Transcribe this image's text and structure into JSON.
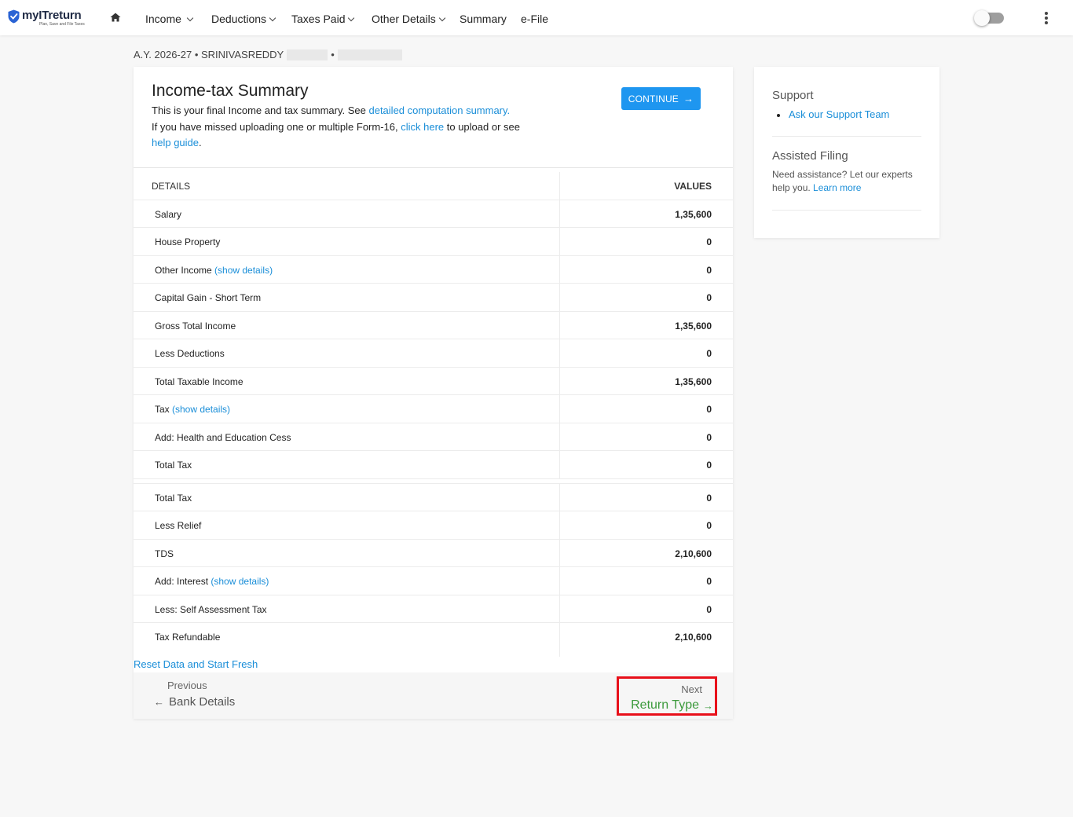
{
  "header": {
    "logo_name": "myITreturn",
    "logo_tagline": "Plan, Save and File Taxes",
    "nav": [
      {
        "label": "Income",
        "has_menu": true
      },
      {
        "label": "Deductions",
        "has_menu": true
      },
      {
        "label": "Taxes Paid",
        "has_menu": true
      },
      {
        "label": "Other Details",
        "has_menu": true
      },
      {
        "label": "Summary",
        "has_menu": false
      },
      {
        "label": "e-File",
        "has_menu": false
      }
    ],
    "toggle_on": false,
    "icons": [
      "shield-check-icon",
      "home-icon",
      "chevron-down-icon",
      "more-vertical-icon"
    ]
  },
  "breadcrumb": {
    "text": "A.Y. 2026-27 • SRINIVASREDDY",
    "separator": "•"
  },
  "summary": {
    "title": "Income-tax Summary",
    "intro_1": "This is your final Income and tax summary. See ",
    "intro_1_link": "detailed computation summary.",
    "intro_2": "If you have missed uploading one or multiple Form-16, ",
    "intro_2_link": "click here",
    "intro_3": " to upload or see ",
    "intro_3_link": "help guide",
    "intro_3_end": ".",
    "continue_label": "CONTINUE",
    "columns": {
      "details": "DETAILS",
      "values": "VALUES"
    },
    "rows_a": [
      {
        "label": "Salary",
        "link": "",
        "value": "1,35,600"
      },
      {
        "label": "House Property",
        "link": "",
        "value": "0"
      },
      {
        "label": "Other Income ",
        "link": "(show details)",
        "value": "0"
      },
      {
        "label": "Capital Gain - Short Term",
        "link": "",
        "value": "0"
      },
      {
        "label": "Gross Total Income",
        "link": "",
        "value": "1,35,600"
      },
      {
        "label": "Less Deductions",
        "link": "",
        "value": "0"
      },
      {
        "label": "Total Taxable Income",
        "link": "",
        "value": "1,35,600"
      },
      {
        "label": "Tax ",
        "link": "(show details)",
        "value": "0"
      },
      {
        "label": "Add: Health and Education Cess",
        "link": "",
        "value": "0"
      },
      {
        "label": "Total Tax",
        "link": "",
        "value": "0"
      }
    ],
    "rows_b": [
      {
        "label": "Total Tax",
        "link": "",
        "value": "0"
      },
      {
        "label": "Less Relief",
        "link": "",
        "value": "0"
      },
      {
        "label": "TDS",
        "link": "",
        "value": "2,10,600"
      },
      {
        "label": "Add: Interest ",
        "link": "(show details)",
        "value": "0"
      },
      {
        "label": "Less: Self Assessment Tax",
        "link": "",
        "value": "0"
      },
      {
        "label": "Tax Refundable",
        "link": "",
        "value": "2,10,600"
      }
    ],
    "reset_label": "Reset Data and Start Fresh"
  },
  "pager": {
    "prev_label": "Previous",
    "prev_target": "Bank Details",
    "next_label": "Next",
    "next_target": "Return Type",
    "next_highlight_color": "#e8101a",
    "next_color": "#3c9a3c"
  },
  "side": {
    "support_title": "Support",
    "support_link": "Ask our Support Team",
    "assisted_title": "Assisted Filing",
    "assisted_text": "Need assistance? Let our experts help you. ",
    "assisted_link": "Learn more"
  },
  "colors": {
    "accent": "#1e96f0",
    "link": "#1a8ed8"
  }
}
